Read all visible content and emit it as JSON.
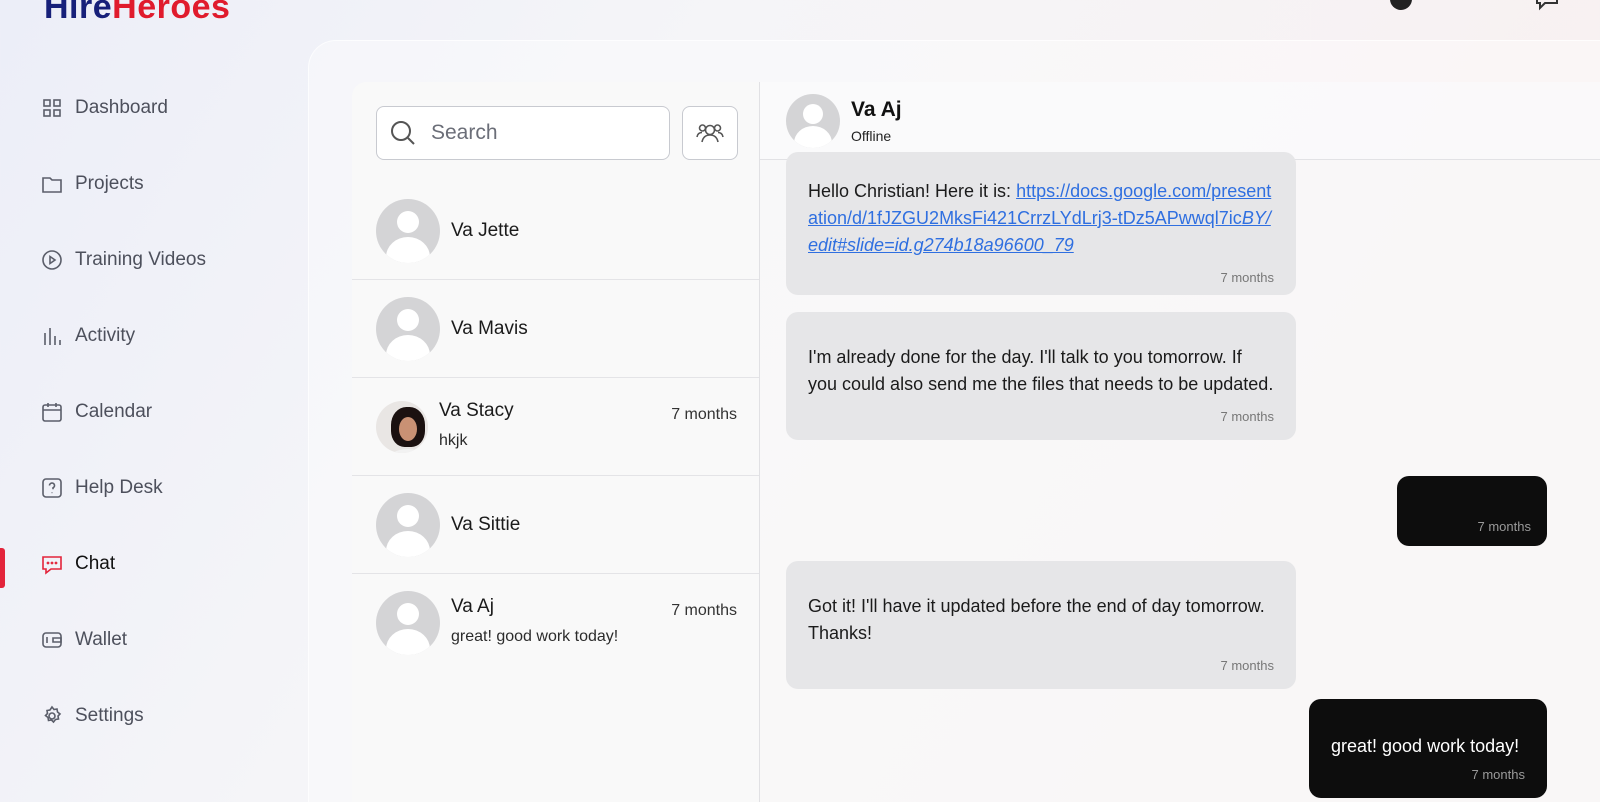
{
  "brand": {
    "part1": "Hire",
    "part2": "Heroes"
  },
  "sidebar": {
    "items": [
      {
        "label": "Dashboard",
        "icon": "grid-icon"
      },
      {
        "label": "Projects",
        "icon": "folder-icon"
      },
      {
        "label": "Training Videos",
        "icon": "play-circle-icon"
      },
      {
        "label": "Activity",
        "icon": "bar-chart-icon"
      },
      {
        "label": "Calendar",
        "icon": "calendar-icon"
      },
      {
        "label": "Help Desk",
        "icon": "help-icon"
      },
      {
        "label": "Chat",
        "icon": "chat-icon",
        "active": true
      },
      {
        "label": "Wallet",
        "icon": "wallet-icon"
      },
      {
        "label": "Settings",
        "icon": "gear-icon"
      }
    ],
    "accent": "#e3243b"
  },
  "search": {
    "placeholder": "Search"
  },
  "contacts": [
    {
      "name": "Va Jette"
    },
    {
      "name": "Va Mavis"
    },
    {
      "name": "Va Stacy",
      "time": "7 months",
      "preview": "hkjk"
    },
    {
      "name": "Va Sittie"
    },
    {
      "name": "Va Aj",
      "time": "7 months",
      "preview": "great! good work today!"
    }
  ],
  "chat": {
    "name": "Va Aj",
    "status": "Offline",
    "messages": [
      {
        "dir": "in",
        "prefix": "Hello Christian! Here it is: ",
        "link_plain": "https://docs.google.com/presentation/d/1fJZGU2MksFi421CrrzLYdLrj3-tDz5APwwql7ic",
        "link_italic": "BY/edit#slide=id.g274b18a96600_79",
        "time": "7 months"
      },
      {
        "dir": "in",
        "text": "I'm already done for the day. I'll talk to you tomorrow. If you could also send me the files that needs to be updated.",
        "time": "7 months"
      },
      {
        "dir": "out",
        "text": "",
        "time": "7 months"
      },
      {
        "dir": "in",
        "text": "Got it! I'll have it updated before the end of day tomorrow. Thanks!",
        "time": "7 months"
      },
      {
        "dir": "out",
        "text": "great! good work today!",
        "time": "7 months"
      }
    ]
  }
}
